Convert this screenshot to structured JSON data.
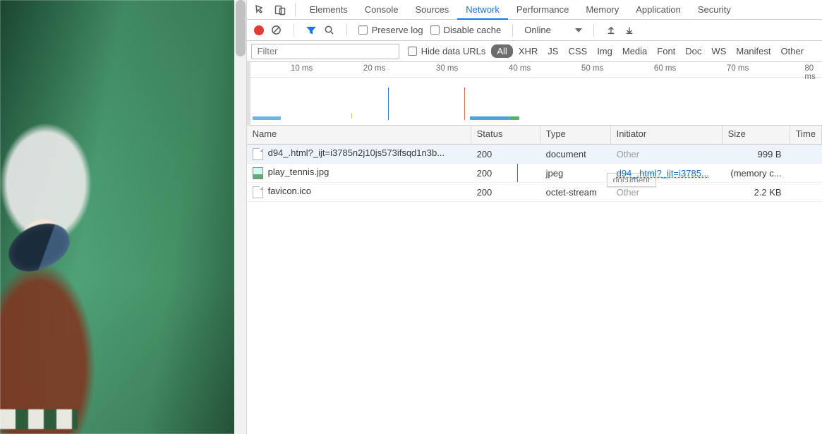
{
  "tabs": [
    "Elements",
    "Console",
    "Sources",
    "Network",
    "Performance",
    "Memory",
    "Application",
    "Security"
  ],
  "active_tab": "Network",
  "toolbar": {
    "preserve_log": "Preserve log",
    "disable_cache": "Disable cache",
    "throttling": "Online"
  },
  "filterbar": {
    "filter_placeholder": "Filter",
    "hide_data_urls": "Hide data URLs",
    "type_pills": [
      "All",
      "XHR",
      "JS",
      "CSS",
      "Img",
      "Media",
      "Font",
      "Doc",
      "WS",
      "Manifest",
      "Other"
    ],
    "active_pill": "All"
  },
  "timeline_ticks": [
    "10 ms",
    "20 ms",
    "30 ms",
    "40 ms",
    "50 ms",
    "60 ms",
    "70 ms",
    "80 ms"
  ],
  "columns": [
    "Name",
    "Status",
    "Type",
    "Initiator",
    "Size",
    "Time"
  ],
  "rows": [
    {
      "name": "d94_.html?_ijt=i3785n2j10js573ifsqd1n3b...",
      "status": "200",
      "type": "document",
      "initiator": "Other",
      "initiator_kind": "other",
      "size": "999 B",
      "icon": "file"
    },
    {
      "name": "play_tennis.jpg",
      "status": "200",
      "type": "jpeg",
      "initiator": "d94_.html?_ijt=i3785...",
      "initiator_kind": "link",
      "size": "(memory c...",
      "icon": "img"
    },
    {
      "name": "favicon.ico",
      "status": "200",
      "type": "octet-stream",
      "initiator": "Other",
      "initiator_kind": "other",
      "size": "2.2 KB",
      "icon": "file"
    }
  ],
  "tooltip_text": "document"
}
